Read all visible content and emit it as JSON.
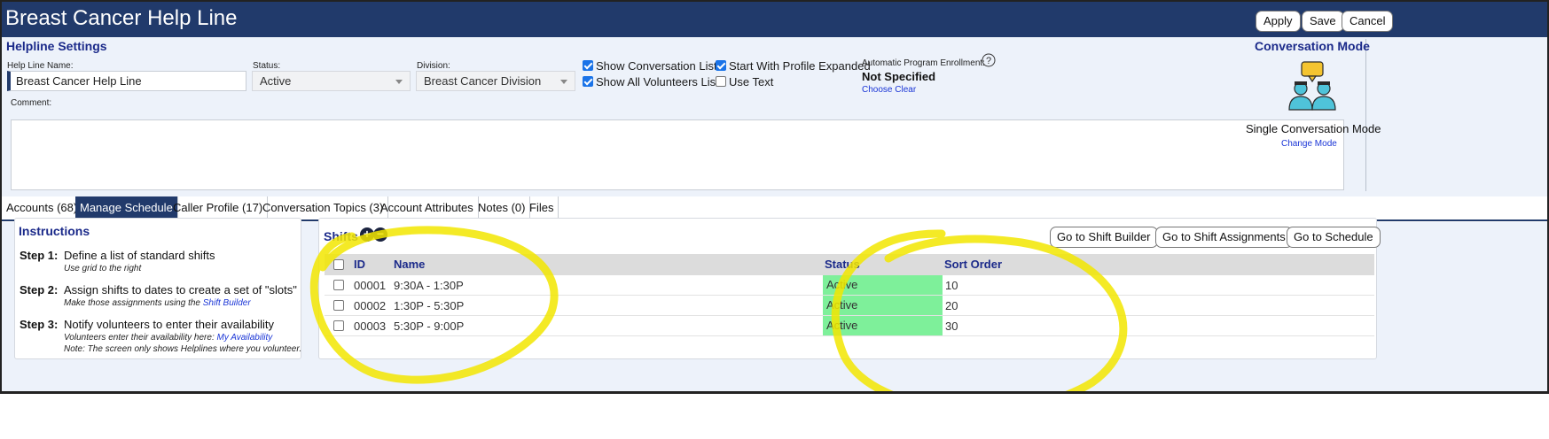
{
  "window": {
    "title": "Breast Cancer Help Line",
    "apply_label": "Apply",
    "save_label": "Save",
    "cancel_label": "Cancel"
  },
  "settings": {
    "heading": "Helpline Settings",
    "name_label": "Help Line Name:",
    "name_value": "Breast Cancer Help Line",
    "status_label": "Status:",
    "status_value": "Active",
    "division_label": "Division:",
    "division_value": "Breast Cancer Division",
    "checkboxes": [
      {
        "label": "Show Conversation List",
        "checked": true
      },
      {
        "label": "Show All Volunteers List",
        "checked": true
      },
      {
        "label": "Start With Profile Expanded",
        "checked": true
      },
      {
        "label": "Use Text",
        "checked": false
      }
    ],
    "enrollment_label": "Automatic Program Enrollment:",
    "enrollment_help_icon": "question-circle-icon",
    "enrollment_value": "Not Specified",
    "choose_label": "Choose",
    "clear_label": "Clear",
    "comment_label": "Comment:",
    "comment_value": ""
  },
  "conversation_mode": {
    "heading": "Conversation Mode",
    "icon": "people-chat-icon",
    "mode": "Single Conversation Mode",
    "change_label": "Change Mode"
  },
  "tabs": [
    {
      "label": "Accounts (68)",
      "active": false
    },
    {
      "label": "Manage Schedule",
      "active": true
    },
    {
      "label": "Caller Profile (17)",
      "active": false
    },
    {
      "label": "Conversation Topics (3)",
      "active": false
    },
    {
      "label": "Account Attributes",
      "active": false
    },
    {
      "label": "Notes (0)",
      "active": false
    },
    {
      "label": "Files",
      "active": false
    }
  ],
  "instructions": {
    "heading": "Instructions",
    "steps": [
      {
        "label": "Step 1:",
        "text": "Define a list of standard shifts",
        "sub1": "Use grid to the right"
      },
      {
        "label": "Step 2:",
        "text": "Assign shifts to dates to create a set of \"slots\"",
        "sub1": "Make those assignments using the ",
        "sub1_link": "Shift Builder"
      },
      {
        "label": "Step 3:",
        "text": "Notify volunteers to enter their availability",
        "sub1": "Volunteers enter their availability here: ",
        "sub1_link": "My Availability",
        "sub2": "Note: The screen only shows Helplines where you volunteer."
      }
    ]
  },
  "shifts": {
    "heading": "Shifts",
    "add_icon": "plus-circle-icon",
    "remove_icon": "minus-circle-icon",
    "buttons": {
      "shift_builder": "Go to Shift Builder",
      "shift_assignments": "Go to Shift Assignments",
      "schedule": "Go to Schedule"
    },
    "columns": {
      "id": "ID",
      "name": "Name",
      "status": "Status",
      "sort_order": "Sort Order"
    },
    "rows": [
      {
        "id": "00001",
        "name": "9:30A - 1:30P",
        "status": "Active",
        "sort_order": "10"
      },
      {
        "id": "00002",
        "name": "1:30P - 5:30P",
        "status": "Active",
        "sort_order": "20"
      },
      {
        "id": "00003",
        "name": "5:30P - 9:00P",
        "status": "Active",
        "sort_order": "30"
      }
    ]
  },
  "colors": {
    "title_bar": "#213a6b",
    "heading": "#1b2a8a",
    "status_active": "#7ef09a",
    "annotation": "#f2e600"
  }
}
